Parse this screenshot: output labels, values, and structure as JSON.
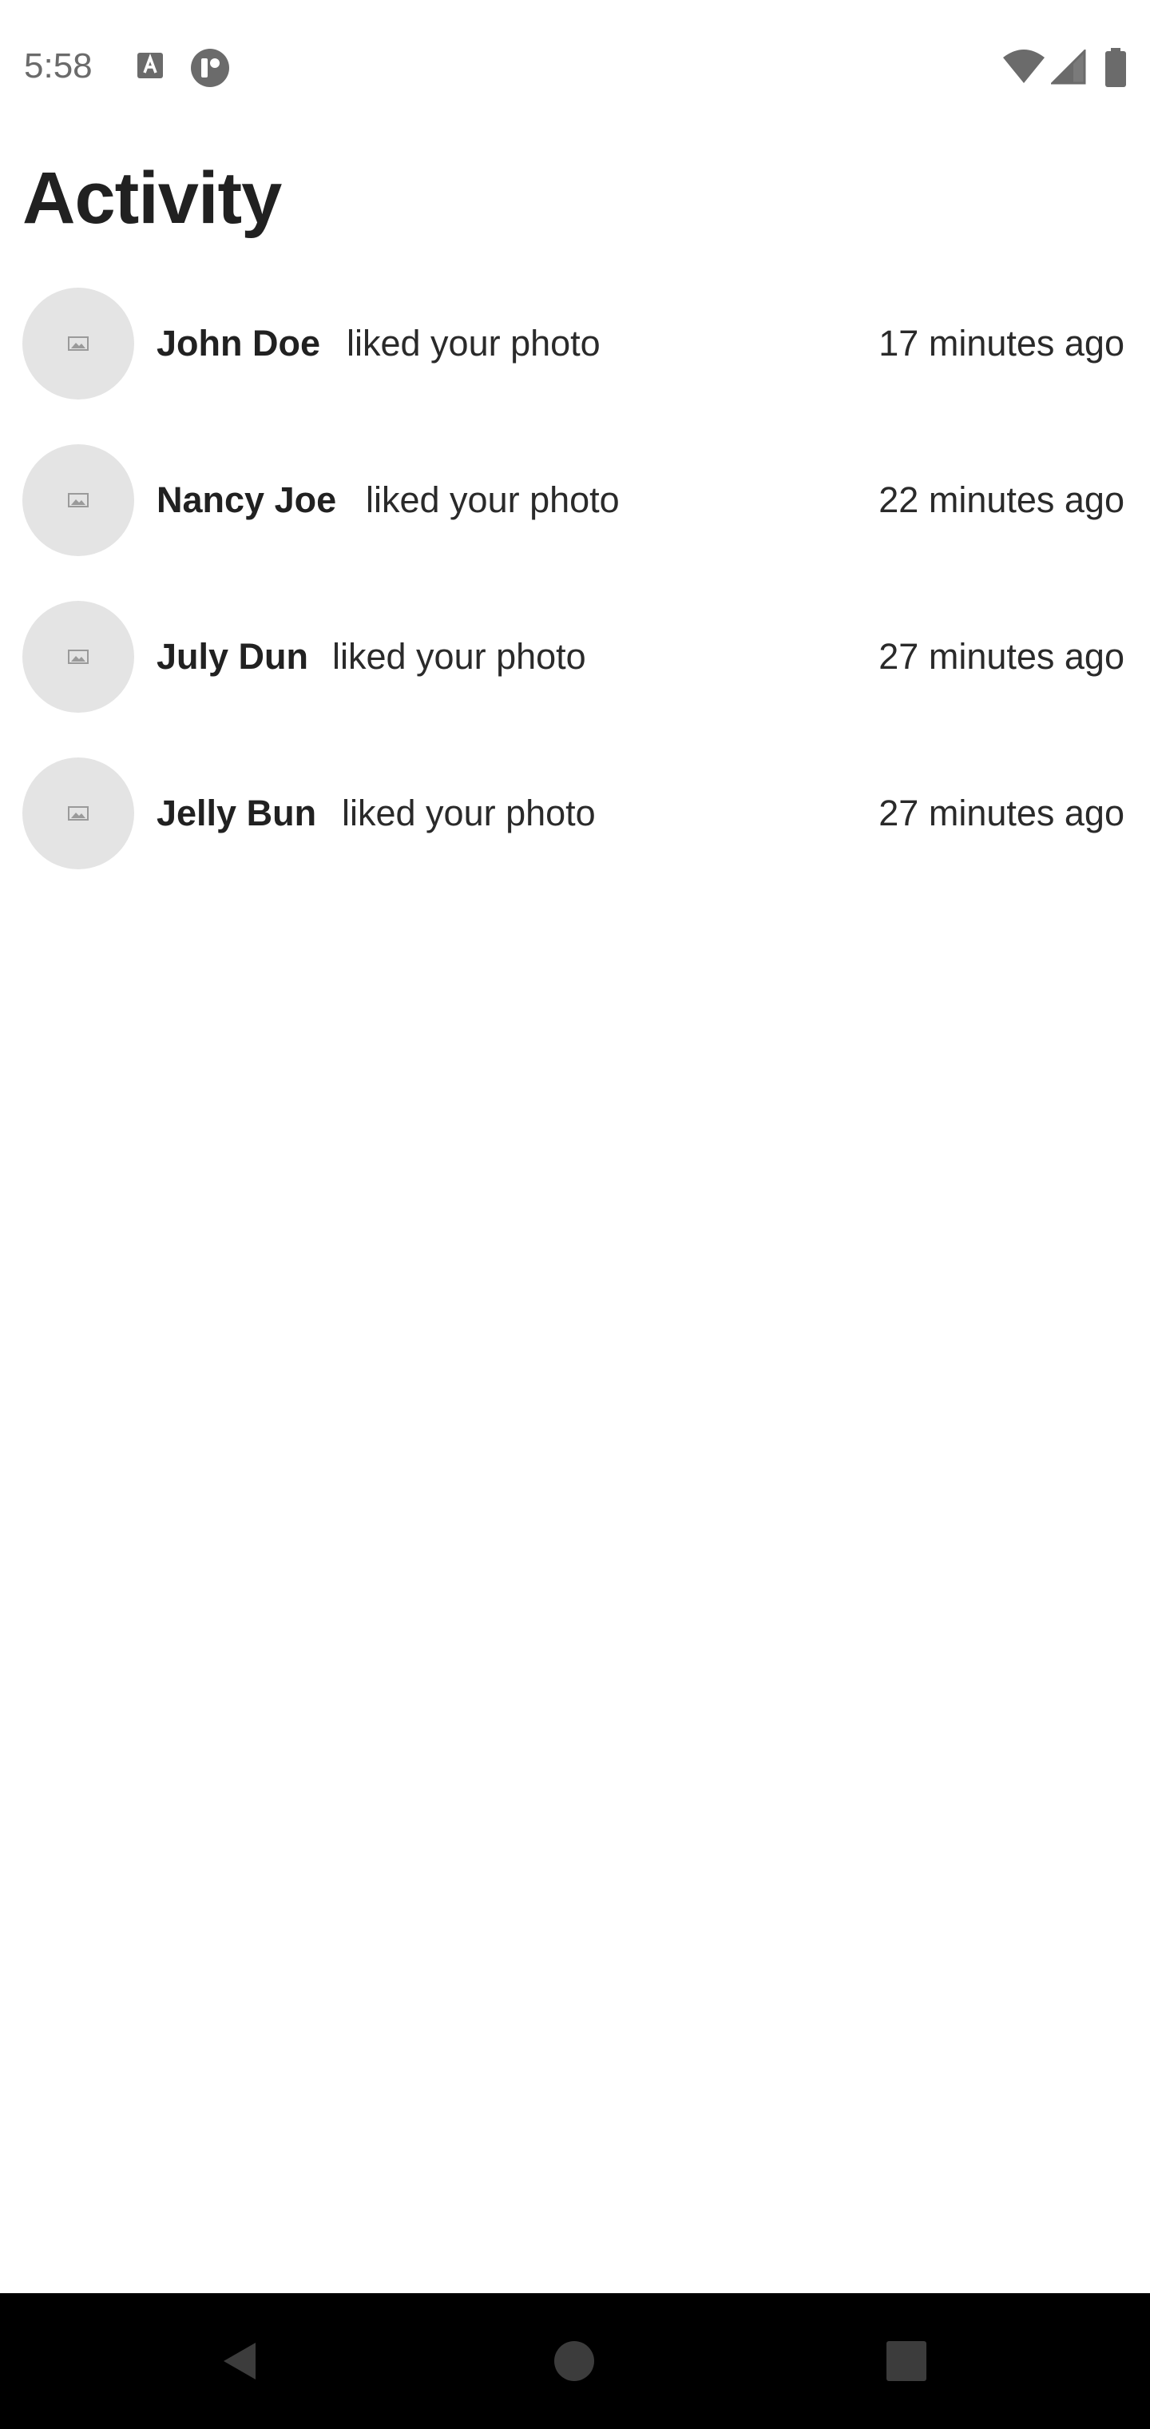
{
  "status_bar": {
    "time": "5:58",
    "icons": [
      "text-a-icon",
      "p-app-icon",
      "wifi-icon",
      "cell-signal-icon",
      "battery-icon"
    ]
  },
  "page": {
    "title": "Activity"
  },
  "activities": [
    {
      "name": "John Doe",
      "action": "liked your photo",
      "time": "17 minutes ago"
    },
    {
      "name": "Nancy Joe",
      "action": "liked your photo",
      "time": "22 minutes ago"
    },
    {
      "name": "July Dun",
      "action": "liked your photo",
      "time": "27 minutes ago"
    },
    {
      "name": "Jelly Bun",
      "action": "liked your photo",
      "time": "27 minutes ago"
    }
  ],
  "nav_bar": {
    "icons": [
      "back-icon",
      "home-icon",
      "recents-icon"
    ]
  },
  "colors": {
    "avatar_bg": "#e4e4e4",
    "nav_bg": "#000000",
    "text": "#212121"
  }
}
